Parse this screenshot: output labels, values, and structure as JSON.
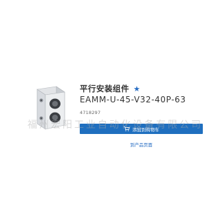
{
  "product": {
    "name": "平行安装组件",
    "code": "EAMM-U-45-V32-40P-63",
    "part_number": "4718297",
    "favorite_icon": "star-icon",
    "image_icon": "mounting-kit-product-image"
  },
  "actions": {
    "add_to_cart_label": "添加到购物车",
    "add_to_cart_icon": "cart-icon",
    "product_page_label": "到产品页面"
  },
  "watermark": {
    "text": "福州宏阳工业自动化设备有限公司"
  },
  "colors": {
    "accent": "#1f6fbf",
    "link": "#2a6fc4",
    "text": "#333333"
  }
}
